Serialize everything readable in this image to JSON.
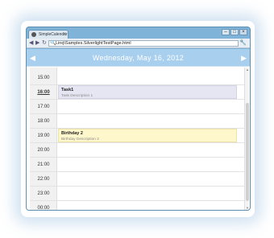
{
  "browser": {
    "tab_title": "SimpleCalendar",
    "tab_close": "×",
    "url": "Linq\\Samples.SilverlightTestPage.html",
    "window_buttons": [
      "–",
      "□",
      "×"
    ],
    "nav_back": "◀",
    "nav_forward": "▶",
    "nav_reload": "↻",
    "url_icon": "🔍",
    "settings_icon": "🔧"
  },
  "calendar": {
    "date_title": "Wednesday, May 16, 2012",
    "prev_arrow": "◀",
    "next_arrow": "▶",
    "times": [
      "15:00",
      "16:00",
      "17:00",
      "18:00",
      "19:00",
      "20:00",
      "21:00",
      "22:00",
      "23:00",
      "00:00"
    ],
    "current_time": "16:00",
    "events": [
      {
        "time": "16:00",
        "title": "Task1",
        "description": "Task Description 1",
        "kind": "task"
      },
      {
        "time": "19:00",
        "title": "Birthday 2",
        "description": "Birthday Description 2",
        "kind": "birthday"
      }
    ]
  },
  "colors": {
    "header": "#a9cfee",
    "task_event": "#e6e6f3",
    "birthday_event": "#fff7cc",
    "window_frame": "#7fb3d7"
  }
}
